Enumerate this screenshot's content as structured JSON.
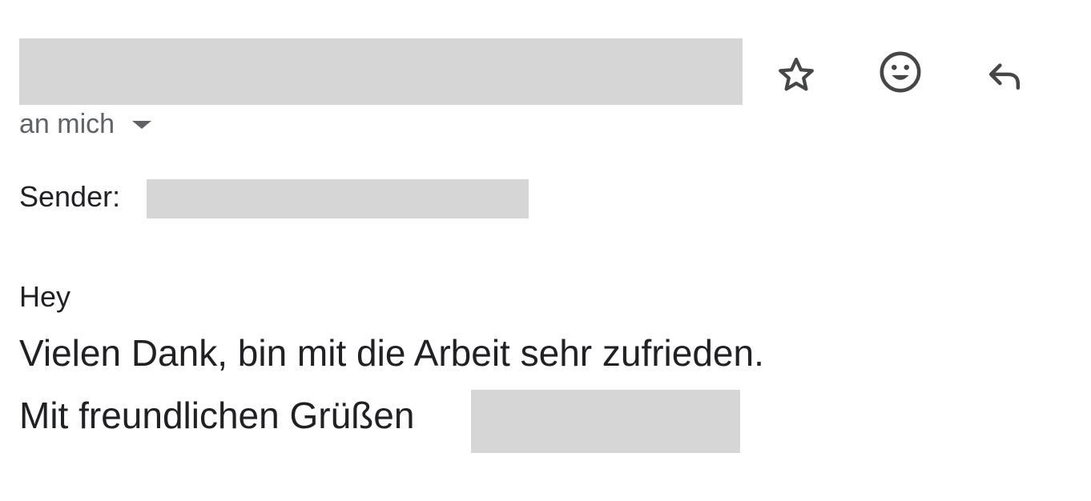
{
  "header": {
    "recipient_text": "an mich",
    "actions": {
      "star_icon": "star-outline-icon",
      "emoji_icon": "emoji-reaction-icon",
      "reply_icon": "reply-icon"
    }
  },
  "meta": {
    "sender_label": "Sender:"
  },
  "body": {
    "greeting": "Hey",
    "thanks": "Vielen Dank, bin mit die Arbeit sehr zufrieden.",
    "closing": "Mit freundlichen Grüßen"
  },
  "colors": {
    "text": "#202124",
    "secondary_text": "#5f6368",
    "icon": "#444746",
    "redaction": "#d6d6d6"
  }
}
